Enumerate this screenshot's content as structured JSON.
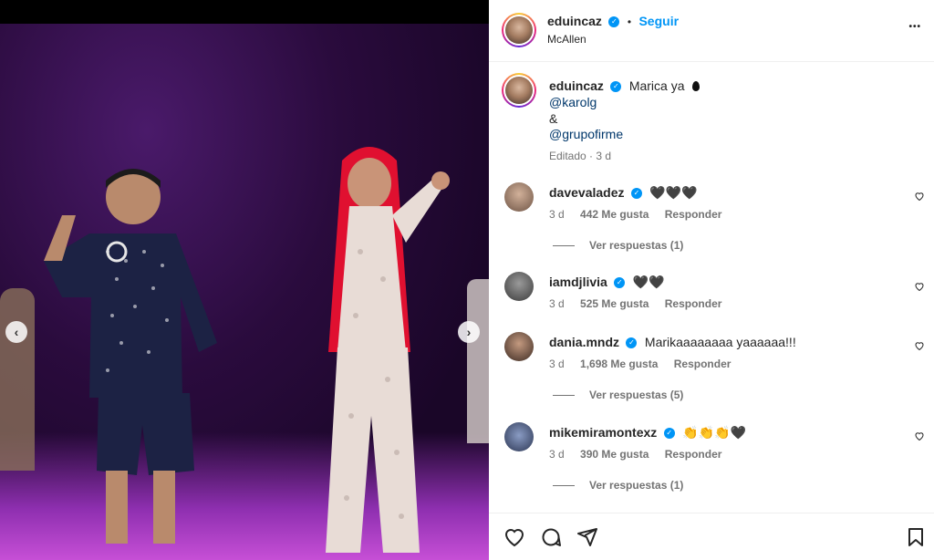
{
  "post": {
    "author": "eduincaz",
    "location": "McAllen",
    "follow_label": "Seguir",
    "dot": "•",
    "more_label": "•••",
    "caption": {
      "text": "Marica ya",
      "mention1": "@karolg",
      "amp": "&",
      "mention2": "@grupofirme",
      "edited": "Editado · 3 d"
    }
  },
  "comments": [
    {
      "user": "davevaladez",
      "text": "🖤🖤🖤",
      "time": "3 d",
      "likes": "442 Me gusta",
      "reply": "Responder",
      "view_replies": "Ver respuestas (1)"
    },
    {
      "user": "iamdjlivia",
      "text": "🖤🖤",
      "time": "3 d",
      "likes": "525 Me gusta",
      "reply": "Responder",
      "view_replies": ""
    },
    {
      "user": "dania.mndz",
      "text": "Marikaaaaaaaa yaaaaaa!!!",
      "time": "3 d",
      "likes": "1,698 Me gusta",
      "reply": "Responder",
      "view_replies": "Ver respuestas (5)"
    },
    {
      "user": "mikemiramontexz",
      "text": "👏👏👏🖤",
      "time": "3 d",
      "likes": "390 Me gusta",
      "reply": "Responder",
      "view_replies": "Ver respuestas (1)"
    }
  ],
  "colors": {
    "accent": "#0095f6",
    "text": "#262626",
    "muted": "#737373",
    "stage_purple": "#2a0b3d"
  }
}
